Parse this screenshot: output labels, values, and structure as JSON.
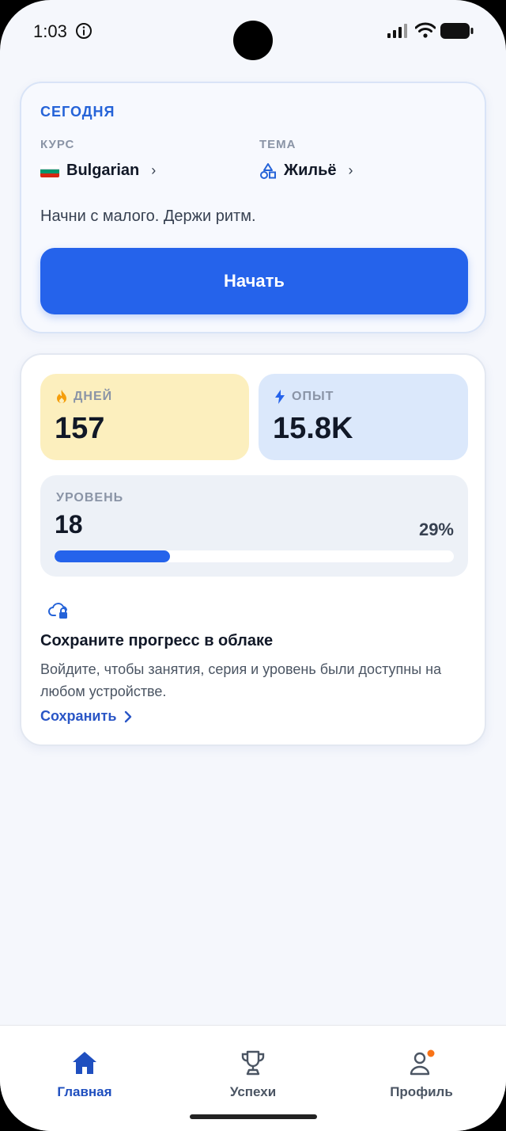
{
  "status_bar": {
    "time": "1:03"
  },
  "today": {
    "title": "СЕГОДНЯ",
    "course_label": "КУРС",
    "course_value": "Bulgarian",
    "topic_label": "ТЕМА",
    "topic_value": "Жильё",
    "tagline": "Начни с малого. Держи ритм.",
    "start_label": "Начать",
    "flag_colors": [
      "#ffffff",
      "#00966e",
      "#d62612"
    ]
  },
  "stats": {
    "days_label": "ДНЕЙ",
    "days_value": "157",
    "xp_label": "ОПЫТ",
    "xp_value": "15.8K",
    "level_label": "УРОВЕНЬ",
    "level_value": "18",
    "level_progress_text": "29%",
    "level_progress": 0.29
  },
  "cloud": {
    "title": "Сохраните прогресс в облаке",
    "description": "Войдите, чтобы занятия, серия и уровень были доступны на любом устройстве.",
    "save_label": "Сохранить"
  },
  "tabs": [
    {
      "label": "Главная",
      "icon": "home-icon",
      "active": true
    },
    {
      "label": "Успехи",
      "icon": "trophy-icon",
      "active": false
    },
    {
      "label": "Профиль",
      "icon": "profile-icon",
      "active": false,
      "badge": true
    }
  ],
  "colors": {
    "accent": "#2563eb",
    "days_tile": "#fcefbe",
    "xp_tile": "#dbe8fb",
    "badge": "#f97316"
  }
}
